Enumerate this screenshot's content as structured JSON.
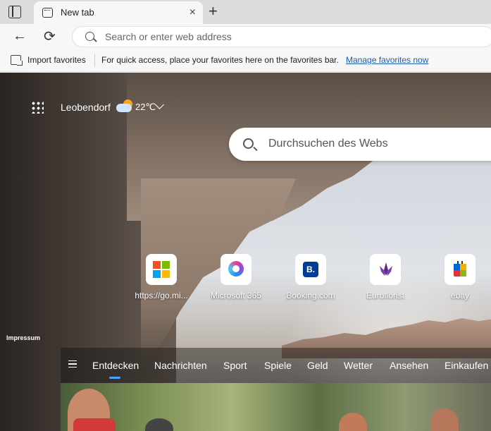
{
  "tab": {
    "title": "New tab",
    "close_label": "×"
  },
  "new_tab_label": "+",
  "toolbar": {
    "back_label": "←",
    "refresh_label": "⟳",
    "address_placeholder": "Search or enter web address"
  },
  "favorites_bar": {
    "import_label": "Import favorites",
    "hint": "For quick access, place your favorites here on the favorites bar.",
    "manage_link": "Manage favorites now"
  },
  "weather": {
    "location": "Leobendorf",
    "temperature": "22℃"
  },
  "web_search": {
    "placeholder": "Durchsuchen des Webs"
  },
  "quick_links": [
    {
      "label": "https://go.mi...",
      "icon": "microsoft-logo-icon"
    },
    {
      "label": "Microsoft 365",
      "icon": "microsoft365-logo-icon"
    },
    {
      "label": "Booking.com",
      "icon": "booking-logo-icon",
      "glyph": "B."
    },
    {
      "label": "Euroflorist",
      "icon": "euroflorist-logo-icon"
    },
    {
      "label": "ebay",
      "icon": "ebay-logo-icon"
    }
  ],
  "footer": {
    "impressum": "Impressum"
  },
  "feed_tabs": [
    {
      "label": "Entdecken",
      "active": true
    },
    {
      "label": "Nachrichten"
    },
    {
      "label": "Sport"
    },
    {
      "label": "Spiele"
    },
    {
      "label": "Geld"
    },
    {
      "label": "Wetter"
    },
    {
      "label": "Ansehen"
    },
    {
      "label": "Einkaufen"
    }
  ],
  "colors": {
    "accent": "#4aa3ff",
    "link": "#1a5fb4",
    "booking": "#003b95"
  }
}
